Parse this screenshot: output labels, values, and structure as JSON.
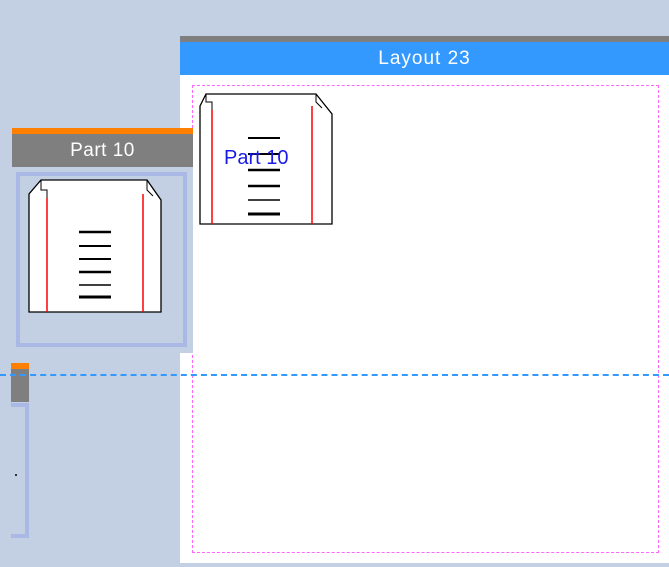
{
  "layout": {
    "title": "Layout 23"
  },
  "part_panel": {
    "title": "Part 10"
  },
  "placed_part": {
    "label": "Part 10"
  },
  "colors": {
    "background": "#c3cfe2",
    "layout_header": "#3399ff",
    "part_header": "#7f7f7f",
    "accent": "#ff8000",
    "margin_dash": "#ff66ff",
    "guide_line": "#3399ff",
    "part_label": "#1a1ae6",
    "bend_line": "#ff0000"
  }
}
